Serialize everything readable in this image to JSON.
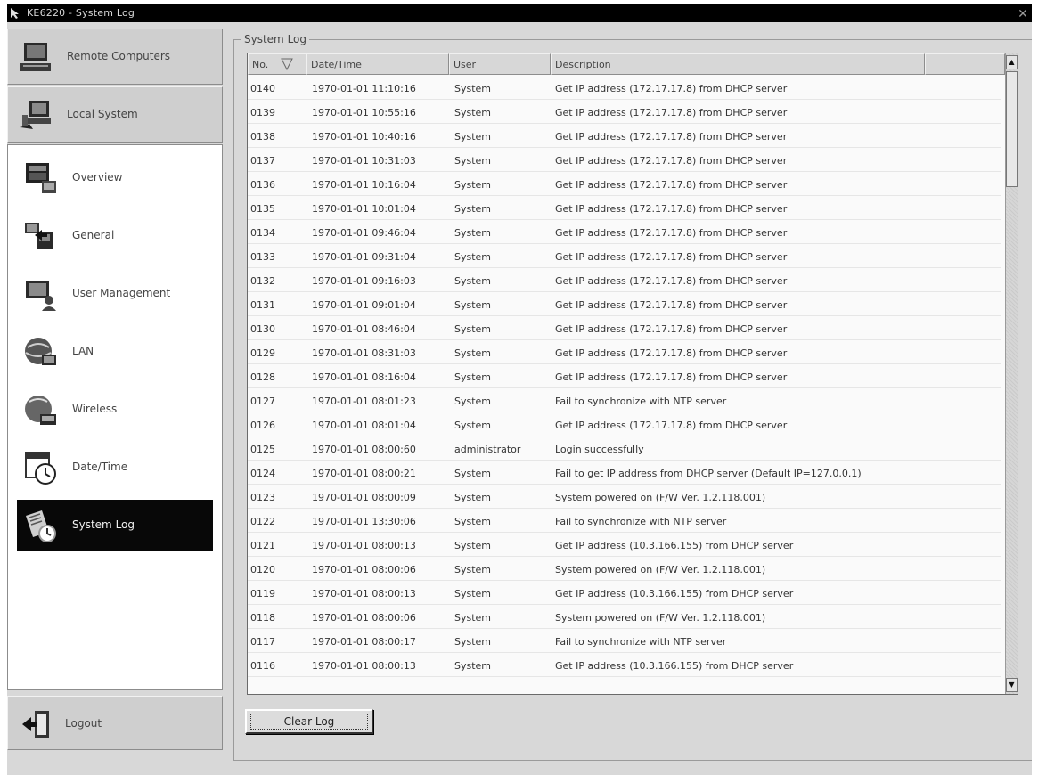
{
  "window": {
    "title": "KE6220 - System Log",
    "close_glyph": "✕"
  },
  "sidebar": {
    "remote_computers": "Remote Computers",
    "local_system": "Local System",
    "items": [
      {
        "label": "Overview",
        "icon": "overview-icon"
      },
      {
        "label": "General",
        "icon": "general-icon"
      },
      {
        "label": "User Management",
        "icon": "user-management-icon"
      },
      {
        "label": "LAN",
        "icon": "lan-icon"
      },
      {
        "label": "Wireless",
        "icon": "wireless-icon"
      },
      {
        "label": "Date/Time",
        "icon": "calendar-clock-icon"
      },
      {
        "label": "System Log",
        "icon": "system-log-icon",
        "active": true
      }
    ],
    "logout": "Logout"
  },
  "system_log": {
    "group_label": "System Log",
    "columns": [
      "No.",
      "Date/Time",
      "User",
      "Description"
    ],
    "rows": [
      [
        "0140",
        "1970-01-01 11:10:16",
        "System",
        "Get IP address (172.17.17.8) from DHCP server"
      ],
      [
        "0139",
        "1970-01-01 10:55:16",
        "System",
        "Get IP address (172.17.17.8) from DHCP server"
      ],
      [
        "0138",
        "1970-01-01 10:40:16",
        "System",
        "Get IP address (172.17.17.8) from DHCP server"
      ],
      [
        "0137",
        "1970-01-01 10:31:03",
        "System",
        "Get IP address (172.17.17.8) from DHCP server"
      ],
      [
        "0136",
        "1970-01-01 10:16:04",
        "System",
        "Get IP address (172.17.17.8) from DHCP server"
      ],
      [
        "0135",
        "1970-01-01 10:01:04",
        "System",
        "Get IP address (172.17.17.8) from DHCP server"
      ],
      [
        "0134",
        "1970-01-01 09:46:04",
        "System",
        "Get IP address (172.17.17.8) from DHCP server"
      ],
      [
        "0133",
        "1970-01-01 09:31:04",
        "System",
        "Get IP address (172.17.17.8) from DHCP server"
      ],
      [
        "0132",
        "1970-01-01 09:16:03",
        "System",
        "Get IP address (172.17.17.8) from DHCP server"
      ],
      [
        "0131",
        "1970-01-01 09:01:04",
        "System",
        "Get IP address (172.17.17.8) from DHCP server"
      ],
      [
        "0130",
        "1970-01-01 08:46:04",
        "System",
        "Get IP address (172.17.17.8) from DHCP server"
      ],
      [
        "0129",
        "1970-01-01 08:31:03",
        "System",
        "Get IP address (172.17.17.8) from DHCP server"
      ],
      [
        "0128",
        "1970-01-01 08:16:04",
        "System",
        "Get IP address (172.17.17.8) from DHCP server"
      ],
      [
        "0127",
        "1970-01-01 08:01:23",
        "System",
        "Fail to synchronize with NTP server"
      ],
      [
        "0126",
        "1970-01-01 08:01:04",
        "System",
        "Get IP address (172.17.17.8) from DHCP server"
      ],
      [
        "0125",
        "1970-01-01 08:00:60",
        "administrator",
        "Login successfully"
      ],
      [
        "0124",
        "1970-01-01 08:00:21",
        "System",
        "Fail to get IP address from DHCP server (Default IP=127.0.0.1)"
      ],
      [
        "0123",
        "1970-01-01 08:00:09",
        "System",
        "System powered on (F/W Ver. 1.2.118.001)"
      ],
      [
        "0122",
        "1970-01-01 13:30:06",
        "System",
        "Fail to synchronize with NTP server"
      ],
      [
        "0121",
        "1970-01-01 08:00:13",
        "System",
        "Get IP address (10.3.166.155) from DHCP server"
      ],
      [
        "0120",
        "1970-01-01 08:00:06",
        "System",
        "System powered on (F/W Ver. 1.2.118.001)"
      ],
      [
        "0119",
        "1970-01-01 08:00:13",
        "System",
        "Get IP address (10.3.166.155) from DHCP server"
      ],
      [
        "0118",
        "1970-01-01 08:00:06",
        "System",
        "System powered on (F/W Ver. 1.2.118.001)"
      ],
      [
        "0117",
        "1970-01-01 08:00:17",
        "System",
        "Fail to synchronize with NTP server"
      ],
      [
        "0116",
        "1970-01-01 08:00:13",
        "System",
        "Get IP address (10.3.166.155) from DHCP server"
      ]
    ],
    "clear_button": "Clear Log"
  }
}
